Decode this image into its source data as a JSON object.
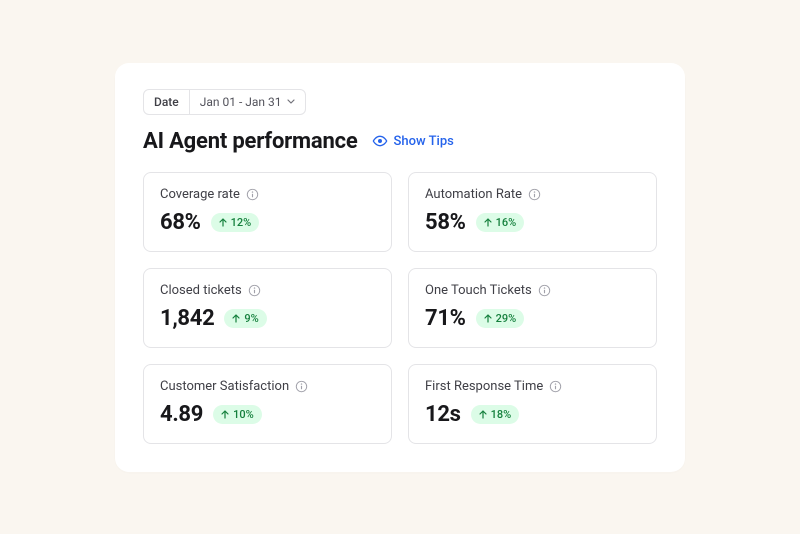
{
  "datePicker": {
    "label": "Date",
    "range": "Jan 01 - Jan 31"
  },
  "header": {
    "title": "AI Agent performance",
    "tipsLabel": "Show Tips"
  },
  "metrics": [
    {
      "label": "Coverage rate",
      "value": "68%",
      "delta": "12%"
    },
    {
      "label": "Automation Rate",
      "value": "58%",
      "delta": "16%"
    },
    {
      "label": "Closed tickets",
      "value": "1,842",
      "delta": "9%"
    },
    {
      "label": "One Touch Tickets",
      "value": "71%",
      "delta": "29%"
    },
    {
      "label": "Customer Satisfaction",
      "value": "4.89",
      "delta": "10%"
    },
    {
      "label": "First Response Time",
      "value": "12s",
      "delta": "18%"
    }
  ]
}
